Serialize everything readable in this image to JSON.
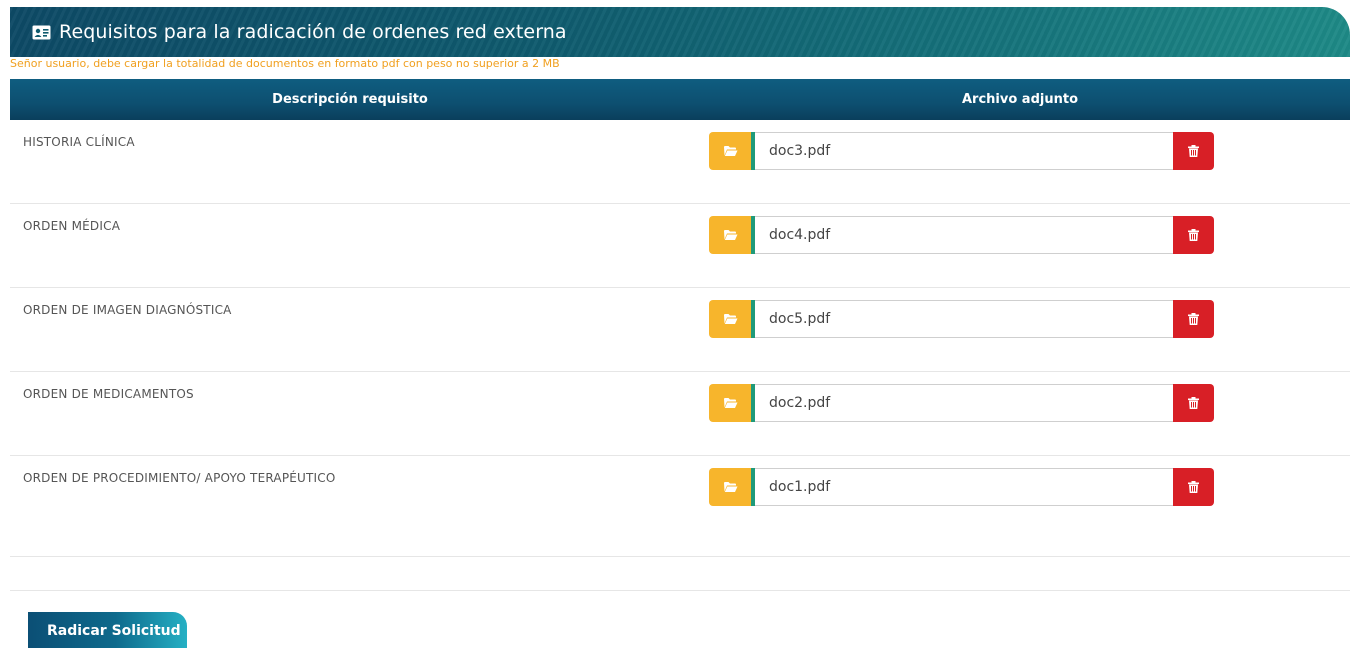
{
  "header": {
    "title": "Requisitos para la radicación de ordenes red externa",
    "icon": "id-card-icon"
  },
  "notice": "Señor usuario, debe cargar la totalidad de documentos en formato pdf con peso no superior a 2 MB",
  "table": {
    "columns": [
      "Descripción requisito",
      "Archivo adjunto"
    ],
    "rows": [
      {
        "label": "HISTORIA CLÍNICA",
        "file": "doc3.pdf"
      },
      {
        "label": "ORDEN MÉDICA",
        "file": "doc4.pdf"
      },
      {
        "label": "ORDEN DE IMAGEN DIAGNÓSTICA",
        "file": "doc5.pdf"
      },
      {
        "label": "ORDEN DE MEDICAMENTOS",
        "file": "doc2.pdf"
      },
      {
        "label": "ORDEN DE PROCEDIMIENTO/ APOYO TERAPÉUTICO",
        "file": "doc1.pdf"
      }
    ]
  },
  "actions": {
    "submit_label": "Radicar Solicitud"
  },
  "colors": {
    "header": "#0f5b6e",
    "notice": "#f0a020",
    "browse": "#f7b52c",
    "delete": "#d81f26",
    "table_header": "#0d4f70"
  }
}
